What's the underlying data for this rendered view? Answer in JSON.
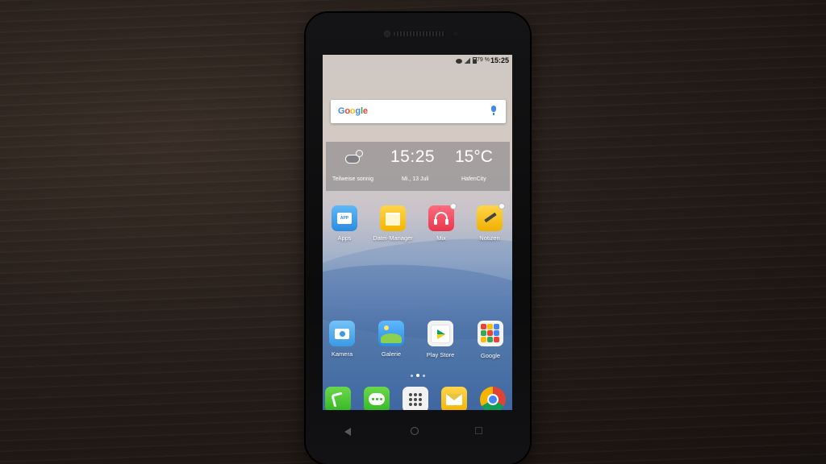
{
  "status_bar": {
    "battery_percent": "79 %",
    "time": "15:25",
    "icons": [
      "data-saver-icon",
      "signal-icon",
      "battery-icon"
    ]
  },
  "google_search": {
    "logo": [
      "G",
      "o",
      "o",
      "g",
      "l",
      "e"
    ],
    "logo_colors": [
      "#4285F4",
      "#EA4335",
      "#FBBC05",
      "#4285F4",
      "#34A853",
      "#EA4335"
    ],
    "mic_icon": "mic-icon"
  },
  "weather": {
    "time": "15:25",
    "temperature": "15°C",
    "condition": "Teilweise sonnig",
    "date": "Mi., 13 Juli",
    "location": "HafenCity",
    "icon": "partly-sunny-icon"
  },
  "home_row_top": [
    {
      "label": "Apps",
      "icon": "apps-store-icon"
    },
    {
      "label": "Datei-Manager",
      "icon": "folder-icon"
    },
    {
      "label": "Mix",
      "icon": "headphones-icon"
    },
    {
      "label": "Notizen",
      "icon": "notes-icon"
    }
  ],
  "inner_text": {
    "apps_badge": "APP"
  },
  "home_row_bottom": [
    {
      "label": "Kamera",
      "icon": "camera-icon"
    },
    {
      "label": "Galerie",
      "icon": "gallery-icon"
    },
    {
      "label": "Play Store",
      "icon": "play-store-icon"
    },
    {
      "label": "Google",
      "icon": "google-folder-icon"
    }
  ],
  "dock": [
    {
      "name": "phone",
      "icon": "phone-icon"
    },
    {
      "name": "messages",
      "icon": "messages-icon"
    },
    {
      "name": "app-drawer",
      "icon": "app-drawer-icon"
    },
    {
      "name": "email",
      "icon": "email-icon"
    },
    {
      "name": "chrome",
      "icon": "chrome-icon"
    }
  ],
  "page_indicator": {
    "pages": 3,
    "current": 2
  },
  "nav_keys": [
    "back-key-icon",
    "home-key-icon",
    "recent-apps-key-icon"
  ],
  "colors": {
    "google_blue": "#4285F4",
    "google_red": "#EA4335",
    "google_yellow": "#FBBC05",
    "google_green": "#34A853"
  }
}
